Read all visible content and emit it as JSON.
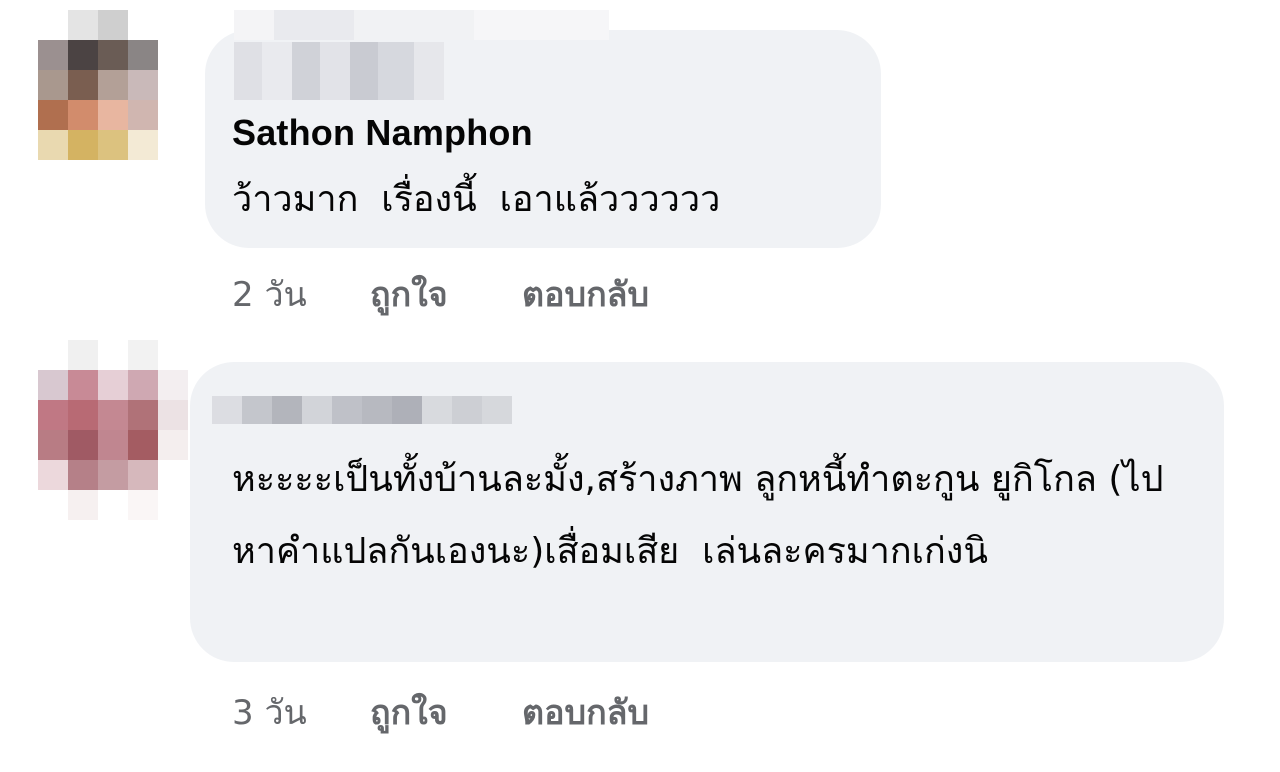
{
  "comments": [
    {
      "author": "Sathon Namphon",
      "text": "ว้าวมาก  เรื่องนี้  เอาแล้วววววว",
      "time": "2 วัน",
      "like_label": "ถูกใจ",
      "reply_label": "ตอบกลับ"
    },
    {
      "author": "",
      "text": "หะะะะเป็นทั้งบ้านละมั้ง,สร้างภาพ ลูกหนี้ทำตะกูน ยูกิโกล (ไปหาคำแปลกันเองนะ)เสื่อมเสีย  เล่นละครมากเก่งนิ",
      "time": "3 วัน",
      "like_label": "ถูกใจ",
      "reply_label": "ตอบกลับ"
    }
  ],
  "colors": {
    "bubble": "#f0f2f5",
    "text": "#050505",
    "secondary": "#65676b"
  }
}
